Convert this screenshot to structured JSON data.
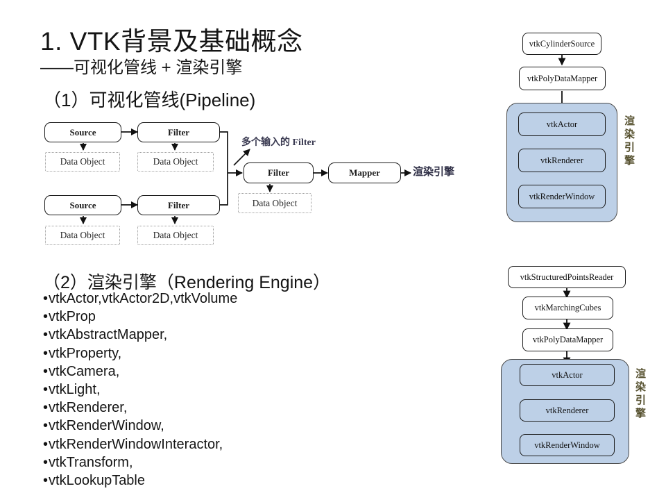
{
  "slide": {
    "title_main": "1. VTK背景及基础概念",
    "title_sub": "——可视化管线 + 渲染引擎",
    "section1_heading": "（1）可视化管线(Pipeline)",
    "section2_heading": "（2）渲染引擎（Rendering Engine）"
  },
  "bullets": [
    {
      "text": "vtkActor,vtkActor2D,vtkVolume"
    },
    {
      "text": "vtkProp"
    },
    {
      "text": "vtkAbstractMapper,"
    },
    {
      "text": "vtkProperty,"
    },
    {
      "text": "vtkCamera,"
    },
    {
      "text": "vtkLight,"
    },
    {
      "text": "vtkRenderer,"
    },
    {
      "text": "vtkRenderWindow,"
    },
    {
      "text": "vtkRenderWindowInteractor,"
    },
    {
      "text": "vtkTransform,"
    },
    {
      "text": "vtkLookupTable"
    }
  ],
  "bullet_marker": "•",
  "pipeline": {
    "boxes": [
      {
        "id": "source-top",
        "label": "Source"
      },
      {
        "id": "filter-top",
        "label": "Filter"
      },
      {
        "id": "data-object-1",
        "label": "Data Object"
      },
      {
        "id": "data-object-2",
        "label": "Data Object"
      },
      {
        "id": "source-bottom",
        "label": "Source"
      },
      {
        "id": "filter-bottom",
        "label": "Filter"
      },
      {
        "id": "data-object-3",
        "label": "Data Object"
      },
      {
        "id": "data-object-4",
        "label": "Data Object"
      },
      {
        "id": "filter-merge",
        "label": "Filter"
      },
      {
        "id": "data-object-5",
        "label": "Data Object"
      },
      {
        "id": "mapper",
        "label": "Mapper"
      }
    ],
    "annotation_multi_input": "多个输入的 Filter",
    "output_label": "渲染引擎"
  },
  "flow_top": {
    "boxes": [
      {
        "id": "vtk-cylinder-source",
        "label": "vtkCylinderSource"
      },
      {
        "id": "vtk-polydata-mapper",
        "label": "vtkPolyDataMapper"
      },
      {
        "id": "vtk-actor",
        "label": "vtkActor"
      },
      {
        "id": "vtk-renderer",
        "label": "vtkRenderer"
      },
      {
        "id": "vtk-render-window",
        "label": "vtkRenderWindow"
      }
    ],
    "engine_label": "渲染引擎"
  },
  "flow_bottom": {
    "boxes": [
      {
        "id": "vtk-structured-points-reader",
        "label": "vtkStructuredPointsReader"
      },
      {
        "id": "vtk-marching-cubes",
        "label": "vtkMarchingCubes"
      },
      {
        "id": "vtk-polydata-mapper",
        "label": "vtkPolyDataMapper"
      },
      {
        "id": "vtk-actor",
        "label": "vtkActor"
      },
      {
        "id": "vtk-renderer",
        "label": "vtkRenderer"
      },
      {
        "id": "vtk-render-window",
        "label": "vtkRenderWindow"
      }
    ],
    "engine_label": "渲染引擎"
  },
  "colors": {
    "engine_fill": "#bdd0e7",
    "engine_label": "#55502e",
    "text": "#141414",
    "box_stroke": "#1a1a1a",
    "dashed_stroke": "#9a9a9a"
  }
}
